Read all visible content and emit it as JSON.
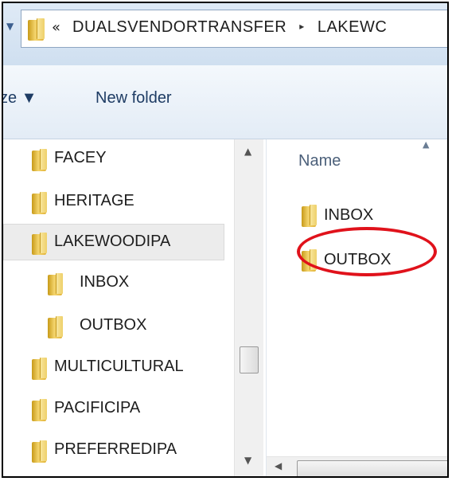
{
  "caption": "OUTBOX folder",
  "address_bar": {
    "chevrons": "«",
    "crumbs": [
      "DUALSVENDORTRANSFER",
      "LAKEWC"
    ],
    "separator": "▸",
    "back_dropdown": "▼"
  },
  "toolbar": {
    "organize_partial": "ze ▼",
    "new_folder_label": "New folder"
  },
  "nav_pane": {
    "items": [
      {
        "label": "FACEY"
      },
      {
        "label": "HERITAGE"
      },
      {
        "label": "LAKEWOODIPA",
        "selected": true
      },
      {
        "label": "INBOX"
      },
      {
        "label": "OUTBOX"
      },
      {
        "label": "MULTICULTURAL"
      },
      {
        "label": "PACIFICIPA"
      },
      {
        "label": "PREFERREDIPA"
      }
    ],
    "scroll_up": "▲",
    "scroll_down": "▼"
  },
  "content_pane": {
    "column_header": "Name",
    "sort_arrow": "▲",
    "items": [
      {
        "label": "INBOX"
      },
      {
        "label": "OUTBOX"
      }
    ],
    "scroll_left": "◀"
  },
  "colors": {
    "highlight": "#e0121b",
    "folder": "#e2b43a",
    "link_text": "#1e3c64"
  },
  "icons": {
    "folder": "folder-icon",
    "dropdown": "chevron-down-icon"
  }
}
